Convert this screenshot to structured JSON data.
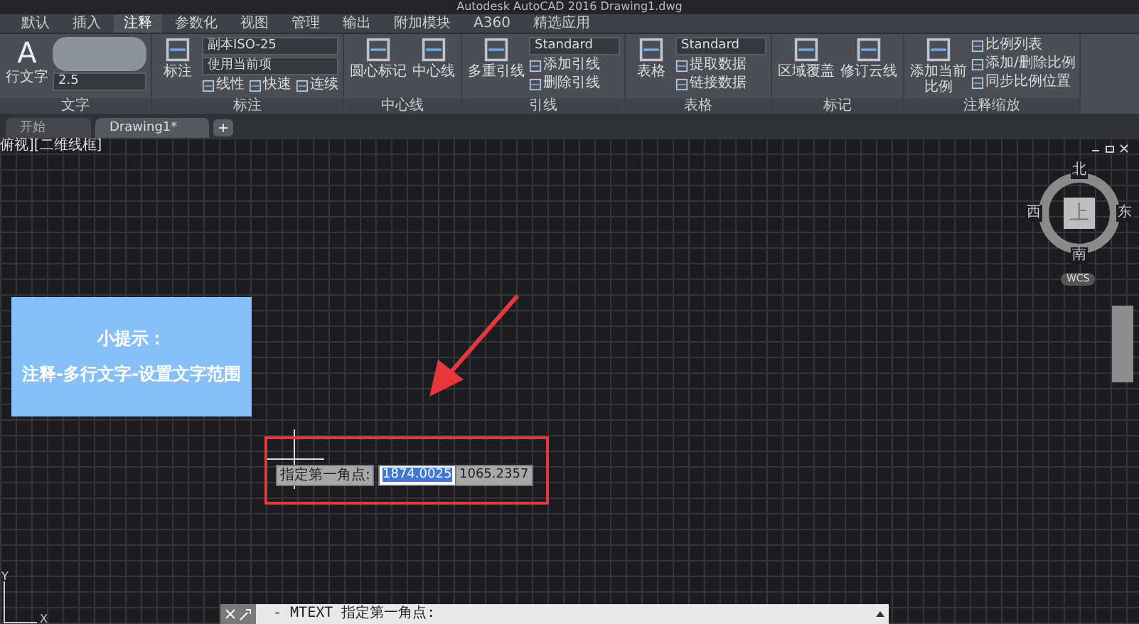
{
  "window": {
    "title": "Autodesk AutoCAD 2016   Drawing1.dwg"
  },
  "ribbon_tabs": [
    {
      "label": "默认",
      "selected": false
    },
    {
      "label": "插入",
      "selected": false
    },
    {
      "label": "注释",
      "selected": true
    },
    {
      "label": "参数化",
      "selected": false
    },
    {
      "label": "视图",
      "selected": false
    },
    {
      "label": "管理",
      "selected": false
    },
    {
      "label": "输出",
      "selected": false
    },
    {
      "label": "附加模块",
      "selected": false
    },
    {
      "label": "A360",
      "selected": false
    },
    {
      "label": "精选应用",
      "selected": false
    }
  ],
  "ribbon_panels": [
    {
      "title": "文字",
      "columns": [
        {
          "kind": "large",
          "label": "行文字",
          "glyph": "A"
        },
        {
          "kind": "stack",
          "items": [
            {
              "kind": "blur"
            },
            {
              "kind": "dropdown",
              "value": "2.5"
            }
          ]
        }
      ]
    },
    {
      "title": "标注",
      "columns": [
        {
          "kind": "large",
          "label": "标注"
        },
        {
          "kind": "stack",
          "items": [
            {
              "kind": "dropdown",
              "value": "副本ISO-25"
            },
            {
              "kind": "dropdown",
              "value": "使用当前项"
            },
            {
              "kind": "row",
              "labels": [
                "线性",
                "快速",
                "连续"
              ]
            }
          ]
        }
      ]
    },
    {
      "title": "中心线",
      "columns": [
        {
          "kind": "large",
          "label": "圆心标记"
        },
        {
          "kind": "large",
          "label": "中心线"
        }
      ]
    },
    {
      "title": "引线",
      "columns": [
        {
          "kind": "large",
          "label": "多重引线"
        },
        {
          "kind": "stack",
          "items": [
            {
              "kind": "dropdown",
              "value": "Standard"
            },
            {
              "kind": "small",
              "label": "添加引线"
            },
            {
              "kind": "small",
              "label": "删除引线"
            }
          ]
        }
      ]
    },
    {
      "title": "表格",
      "columns": [
        {
          "kind": "large",
          "label": "表格"
        },
        {
          "kind": "stack",
          "items": [
            {
              "kind": "dropdown",
              "value": "Standard"
            },
            {
              "kind": "small",
              "label": "提取数据"
            },
            {
              "kind": "small",
              "label": "链接数据"
            }
          ]
        }
      ]
    },
    {
      "title": "标记",
      "columns": [
        {
          "kind": "large",
          "label": "区域覆盖"
        },
        {
          "kind": "large",
          "label": "修订云线"
        }
      ]
    },
    {
      "title": "注释缩放",
      "columns": [
        {
          "kind": "large",
          "label": "添加当前比例"
        },
        {
          "kind": "stack",
          "items": [
            {
              "kind": "small",
              "label": "比例列表"
            },
            {
              "kind": "small",
              "label": "添加/删除比例"
            },
            {
              "kind": "small",
              "label": "同步比例位置"
            }
          ]
        }
      ]
    }
  ],
  "file_tabs": [
    {
      "label": "开始",
      "selected": false
    },
    {
      "label": "Drawing1*",
      "selected": true
    }
  ],
  "viewport": {
    "label": "俯视][二维线框]",
    "tip": {
      "title": "小提示：",
      "text": "注释-多行文字-设置文字范围"
    },
    "prompt": {
      "label": "指定第一角点:",
      "x_value": "1874.0025",
      "y_value": "1065.2357"
    },
    "viewcube": {
      "top": "上",
      "north": "北",
      "south": "南",
      "east": "东",
      "west": "西",
      "wcs": "WCS"
    },
    "axes": {
      "y": "Y",
      "x": "X"
    }
  },
  "command_line": {
    "text": "- MTEXT 指定第一角点:"
  }
}
